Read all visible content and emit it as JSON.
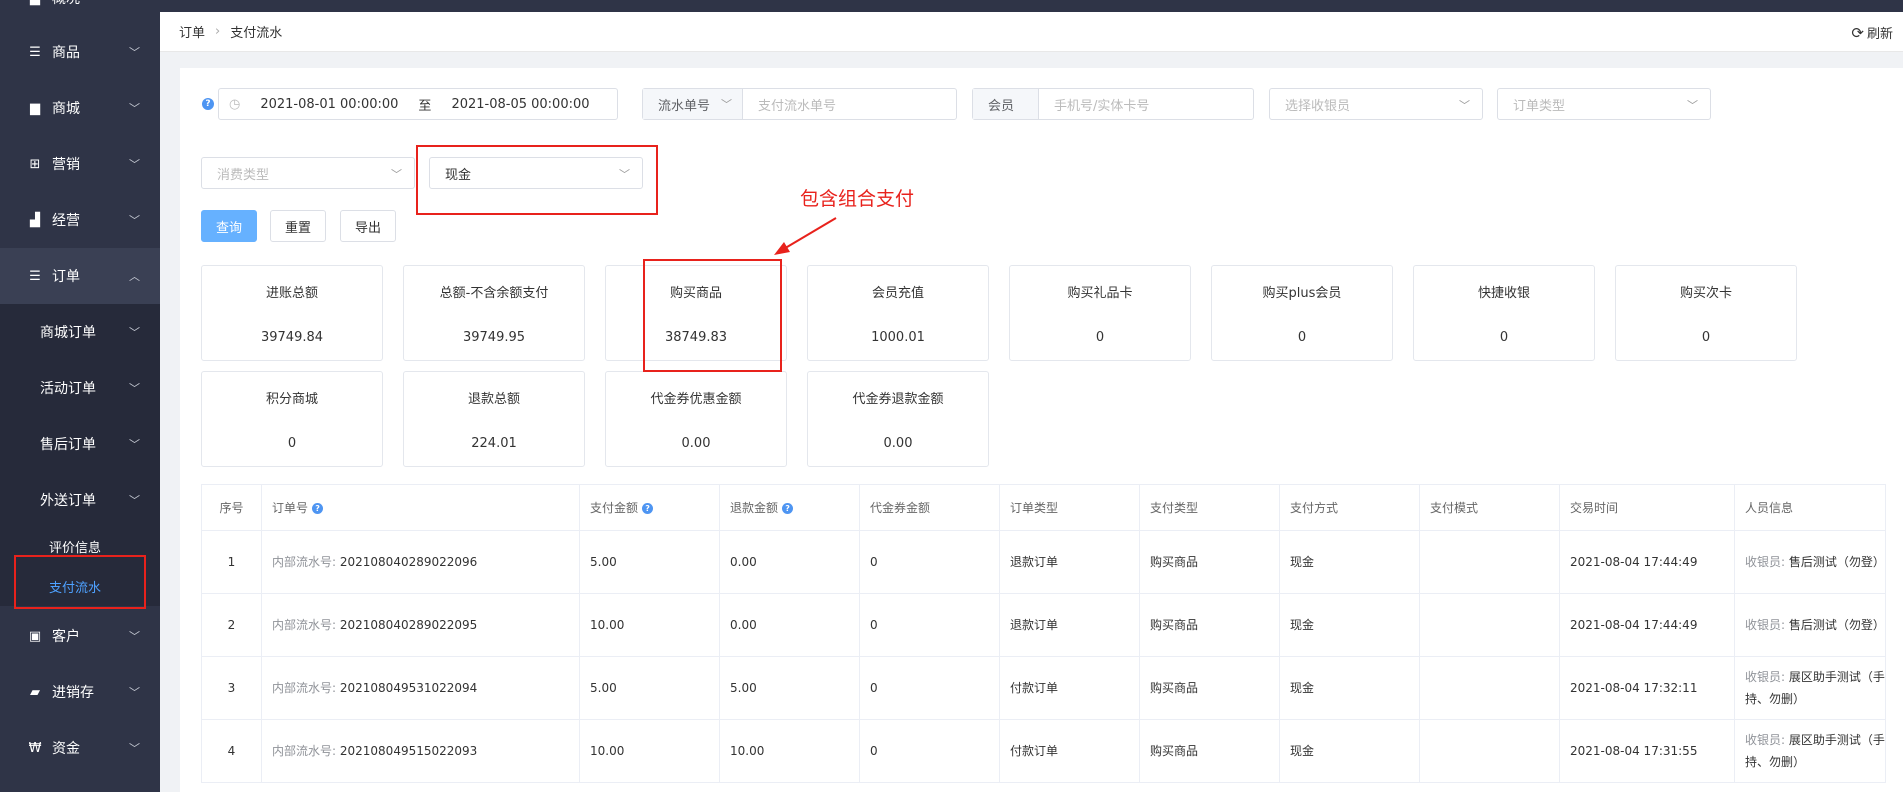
{
  "sidebar": {
    "top_cut_label": "概况",
    "items": [
      {
        "label": "商品",
        "icon": "list-icon"
      },
      {
        "label": "商城",
        "icon": "bag-icon"
      },
      {
        "label": "营销",
        "icon": "gift-icon"
      },
      {
        "label": "经营",
        "icon": "bar-chart-icon"
      },
      {
        "label": "订单",
        "icon": "list-icon"
      }
    ],
    "order_sub": [
      {
        "label": "商城订单"
      },
      {
        "label": "活动订单"
      },
      {
        "label": "售后订单"
      },
      {
        "label": "外送订单"
      }
    ],
    "leaves": [
      "评价信息",
      "支付流水"
    ],
    "bottom_items": [
      {
        "label": "客户",
        "icon": "id-card-icon"
      },
      {
        "label": "进销存",
        "icon": "truck-icon"
      },
      {
        "label": "资金",
        "icon": "yen-icon"
      }
    ]
  },
  "header": {
    "breadcrumb": [
      "订单",
      "支付流水"
    ],
    "refresh_label": "刷新"
  },
  "filters": {
    "date_start": "2021-08-01 00:00:00",
    "date_sep": "至",
    "date_end": "2021-08-05 00:00:00",
    "serial_type_label": "流水单号",
    "serial_placeholder": "支付流水单号",
    "member_label": "会员",
    "member_placeholder": "手机号/实体卡号",
    "cashier_placeholder": "选择收银员",
    "order_type_placeholder": "订单类型",
    "consume_type_placeholder": "消费类型",
    "pay_method_value": "现金"
  },
  "buttons": {
    "query": "查询",
    "reset": "重置",
    "export": "导出"
  },
  "annotation": "包含组合支付",
  "stats": [
    {
      "label": "进账总额",
      "value": "39749.84"
    },
    {
      "label": "总额-不含余额支付",
      "value": "39749.95"
    },
    {
      "label": "购买商品",
      "value": "38749.83"
    },
    {
      "label": "会员充值",
      "value": "1000.01"
    },
    {
      "label": "购买礼品卡",
      "value": "0"
    },
    {
      "label": "购买plus会员",
      "value": "0"
    },
    {
      "label": "快捷收银",
      "value": "0"
    },
    {
      "label": "购买次卡",
      "value": "0"
    },
    {
      "label": "积分商城",
      "value": "0"
    },
    {
      "label": "退款总额",
      "value": "224.01"
    },
    {
      "label": "代金券优惠金额",
      "value": "0.00"
    },
    {
      "label": "代金券退款金额",
      "value": "0.00"
    }
  ],
  "table": {
    "columns": [
      "序号",
      "订单号",
      "支付金额",
      "退款金额",
      "代金券金额",
      "订单类型",
      "支付类型",
      "支付方式",
      "支付模式",
      "交易时间",
      "人员信息"
    ],
    "rows": [
      {
        "no": "1",
        "order_prefix": "内部流水号:",
        "order_no": "202108040289022096",
        "pay": "5.00",
        "refund": "0.00",
        "voucher": "0",
        "order_type": "退款订单",
        "pay_type": "购买商品",
        "pay_method": "现金",
        "pay_mode": "",
        "time": "2021-08-04 17:44:49",
        "staff_prefix": "收银员:",
        "staff": "售后测试（勿登）"
      },
      {
        "no": "2",
        "order_prefix": "内部流水号:",
        "order_no": "202108040289022095",
        "pay": "10.00",
        "refund": "0.00",
        "voucher": "0",
        "order_type": "退款订单",
        "pay_type": "购买商品",
        "pay_method": "现金",
        "pay_mode": "",
        "time": "2021-08-04 17:44:49",
        "staff_prefix": "收银员:",
        "staff": "售后测试（勿登）"
      },
      {
        "no": "3",
        "order_prefix": "内部流水号:",
        "order_no": "202108049531022094",
        "pay": "5.00",
        "refund": "5.00",
        "voucher": "0",
        "order_type": "付款订单",
        "pay_type": "购买商品",
        "pay_method": "现金",
        "pay_mode": "",
        "time": "2021-08-04 17:32:11",
        "staff_prefix": "收银员:",
        "staff": "展区助手测试（手持、勿删）"
      },
      {
        "no": "4",
        "order_prefix": "内部流水号:",
        "order_no": "202108049515022093",
        "pay": "10.00",
        "refund": "10.00",
        "voucher": "0",
        "order_type": "付款订单",
        "pay_type": "购买商品",
        "pay_method": "现金",
        "pay_mode": "",
        "time": "2021-08-04 17:31:55",
        "staff_prefix": "收银员:",
        "staff": "展区助手测试（手持、勿删）"
      }
    ]
  }
}
